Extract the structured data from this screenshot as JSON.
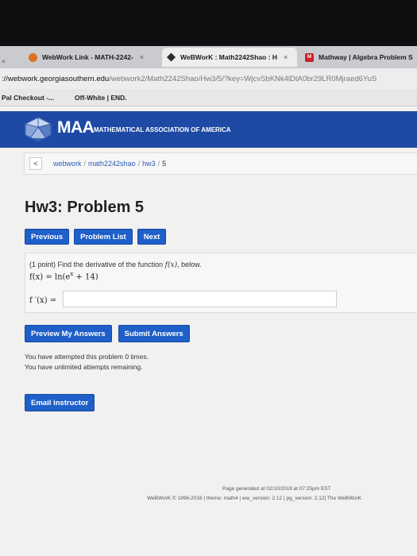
{
  "browser": {
    "tabs": [
      {
        "label": "WebWork Link - MATH-2242-",
        "close": "×"
      },
      {
        "label": "WeBWorK : Math2242Shao : H",
        "close": "×"
      },
      {
        "label": "Mathway | Algebra Problem S",
        "close": ""
      }
    ],
    "left_close": "×",
    "url_host": "://webwork.georgiasouthern.edu",
    "url_path": "/webwork2/Math2242Shao/Hw3/5/?key=WjcvSbKNk4lDtA0br29LR0Mjraed6YuS",
    "bookmarks": [
      "Pal Checkout -...",
      "Off-White | END."
    ]
  },
  "header": {
    "logo_text": "MAA",
    "org_name": "MATHEMATICAL ASSOCIATION OF AMERICA"
  },
  "breadcrumb": {
    "back": "<",
    "items": [
      "webwork",
      "math2242shao",
      "hw3",
      "5"
    ],
    "separator": "/"
  },
  "problem": {
    "title": "Hw3: Problem 5",
    "nav": {
      "previous": "Previous",
      "list": "Problem List",
      "next": "Next"
    },
    "points": "(1 point)",
    "prompt": "Find the derivative of the function",
    "prompt_fn": "f(x)",
    "prompt_end": ", below.",
    "equation_lhs": "f(x) = ln(e",
    "equation_exp": "x",
    "equation_rhs": " + 14)",
    "answer_label": "f ′(x) =",
    "answer_value": ""
  },
  "actions": {
    "preview": "Preview My Answers",
    "submit": "Submit Answers"
  },
  "attempts": {
    "line1": "You have attempted this problem 0 times.",
    "line2": "You have unlimited attempts remaining."
  },
  "email": {
    "label": "Email instructor"
  },
  "footer": {
    "generated": "Page generated at 02/10/2019 at 07:25pm EST",
    "credits": "WeBWorK © 1996-2016 | theme: math4 | ww_version: 2.12 | pg_version: 2.12| The WeBWorK"
  },
  "colors": {
    "header_blue": "#1e4aa6",
    "button_blue": "#1f5fc9"
  }
}
